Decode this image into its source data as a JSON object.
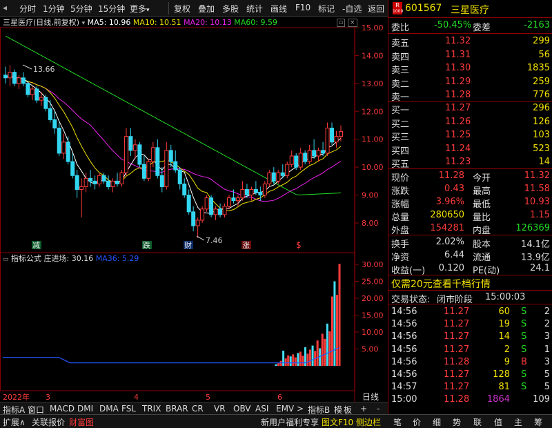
{
  "toolbar": {
    "fenshi": "分时",
    "m1": "1分钟",
    "m5": "5分钟",
    "m15": "15分钟",
    "more": "更多",
    "fuquan": "复权",
    "diejia": "叠加",
    "duogu": "多股",
    "tongji": "统计",
    "huaxian": "画线",
    "f10": "F10",
    "biaoji": "标记",
    "zixuan": "-自选",
    "fanhui": "返回"
  },
  "main": {
    "title": "三星医疗(日线,前复权)",
    "ma5": "MA5: 10.96",
    "ma10": "MA10: 10.51",
    "ma20": "MA20: 10.13",
    "ma60": "MA60: 9.59",
    "high_label": "13.66",
    "low_label": "7.46",
    "y_ticks": [
      "15.00",
      "14.00",
      "13.00",
      "12.00",
      "11.00",
      "10.00",
      "9.00",
      "8.00"
    ],
    "signals": [
      "减",
      "跌",
      "财",
      "涨",
      "$"
    ]
  },
  "indicator": {
    "name": "指标公式",
    "zjc": "庄进场: 30.16",
    "ma36": "MA36: 5.29",
    "y_ticks": [
      "30.00",
      "25.00",
      "20.00",
      "15.00",
      "10.00",
      "5.00"
    ]
  },
  "xaxis": {
    "year": "2022年",
    "m3": "3",
    "m4": "4",
    "m5": "5",
    "m6": "6",
    "period": "日线"
  },
  "bottom_tabs": [
    "指标A",
    "窗口",
    "MACD",
    "DMI",
    "DMA",
    "FSL",
    "TRIX",
    "BRAR",
    "CR",
    "VR",
    "OBV",
    "ASI",
    "EMV",
    ">",
    "指标B",
    "模",
    "板",
    "+",
    "-"
  ],
  "footer": {
    "kuozhan": "扩展∧",
    "guanlian": "关联报价",
    "caifu": "财富图",
    "promo": "新用户福利专享",
    "tuwen": "图文F10",
    "cebian": "侧边栏",
    "nav": [
      "笔",
      "价",
      "细",
      "势",
      "联",
      "值",
      "主",
      "筹"
    ]
  },
  "quote": {
    "badge": "R",
    "badge_num": "1000",
    "code": "601567",
    "name": "三星医疗",
    "weibi_label": "委比",
    "weibi": "-50.45%",
    "weicha_label": "委差",
    "weicha": "-2163",
    "asks": [
      {
        "label": "卖五",
        "price": "11.32",
        "vol": "299"
      },
      {
        "label": "卖四",
        "price": "11.31",
        "vol": "56"
      },
      {
        "label": "卖三",
        "price": "11.30",
        "vol": "1835"
      },
      {
        "label": "卖二",
        "price": "11.29",
        "vol": "259"
      },
      {
        "label": "卖一",
        "price": "11.28",
        "vol": "776"
      }
    ],
    "bids": [
      {
        "label": "买一",
        "price": "11.27",
        "vol": "296"
      },
      {
        "label": "买二",
        "price": "11.26",
        "vol": "126"
      },
      {
        "label": "买三",
        "price": "11.25",
        "vol": "103"
      },
      {
        "label": "买四",
        "price": "11.24",
        "vol": "523"
      },
      {
        "label": "买五",
        "price": "11.23",
        "vol": "14"
      }
    ],
    "stats": [
      {
        "l1": "现价",
        "v1": "11.28",
        "l2": "今开",
        "v2": "11.32",
        "c1": "#ff3b3b",
        "c2": "#ff3b3b"
      },
      {
        "l1": "涨跌",
        "v1": "0.43",
        "l2": "最高",
        "v2": "11.58",
        "c1": "#ff3b3b",
        "c2": "#ff3b3b"
      },
      {
        "l1": "涨幅",
        "v1": "3.96%",
        "l2": "最低",
        "v2": "10.93",
        "c1": "#ff3b3b",
        "c2": "#ff3b3b"
      },
      {
        "l1": "总量",
        "v1": "280650",
        "l2": "量比",
        "v2": "1.15",
        "c1": "#f0e000",
        "c2": "#ff3b3b"
      },
      {
        "l1": "外盘",
        "v1": "154281",
        "l2": "内盘",
        "v2": "126369",
        "c1": "#ff3b3b",
        "c2": "#22dd22"
      }
    ],
    "stats2": [
      {
        "l1": "换手",
        "v1": "2.02%",
        "l2": "股本",
        "v2": "14.1亿"
      },
      {
        "l1": "净资",
        "v1": "6.44",
        "l2": "流通",
        "v2": "13.9亿"
      },
      {
        "l1": "收益(一)",
        "v1": "0.120",
        "l2": "PE(动)",
        "v2": "24.1"
      }
    ],
    "promo": "仅需20元查看千档行情",
    "status_label": "交易状态:",
    "status": "闭市阶段",
    "status_time": "15:00:03",
    "ticks": [
      {
        "t": "14:56",
        "p": "11.27",
        "v": "60",
        "s": "S",
        "n": "2",
        "vc": "#f0e000",
        "sc": "#22dd22"
      },
      {
        "t": "14:56",
        "p": "11.27",
        "v": "19",
        "s": "S",
        "n": "2",
        "vc": "#f0e000",
        "sc": "#22dd22"
      },
      {
        "t": "14:56",
        "p": "11.27",
        "v": "14",
        "s": "S",
        "n": "3",
        "vc": "#f0e000",
        "sc": "#22dd22"
      },
      {
        "t": "14:56",
        "p": "11.27",
        "v": "2",
        "s": "S",
        "n": "1",
        "vc": "#f0e000",
        "sc": "#22dd22"
      },
      {
        "t": "14:56",
        "p": "11.28",
        "v": "9",
        "s": "B",
        "n": "3",
        "vc": "#f0e000",
        "sc": "#ff3b3b"
      },
      {
        "t": "14:56",
        "p": "11.27",
        "v": "128",
        "s": "S",
        "n": "5",
        "vc": "#f0e000",
        "sc": "#22dd22"
      },
      {
        "t": "14:57",
        "p": "11.27",
        "v": "81",
        "s": "S",
        "n": "5",
        "vc": "#f0e000",
        "sc": "#22dd22"
      },
      {
        "t": "15:00",
        "p": "11.28",
        "v": "1864",
        "s": "",
        "n": "109",
        "vc": "#cc33cc",
        "sc": "#ccc"
      }
    ]
  },
  "colors": {
    "up": "#ff3b3b",
    "down": "#33d6f0",
    "ma5": "#ffffff",
    "ma10": "#f0e000",
    "ma20": "#ee22ee",
    "ma60": "#22dd22",
    "frame": "#8a0000"
  }
}
